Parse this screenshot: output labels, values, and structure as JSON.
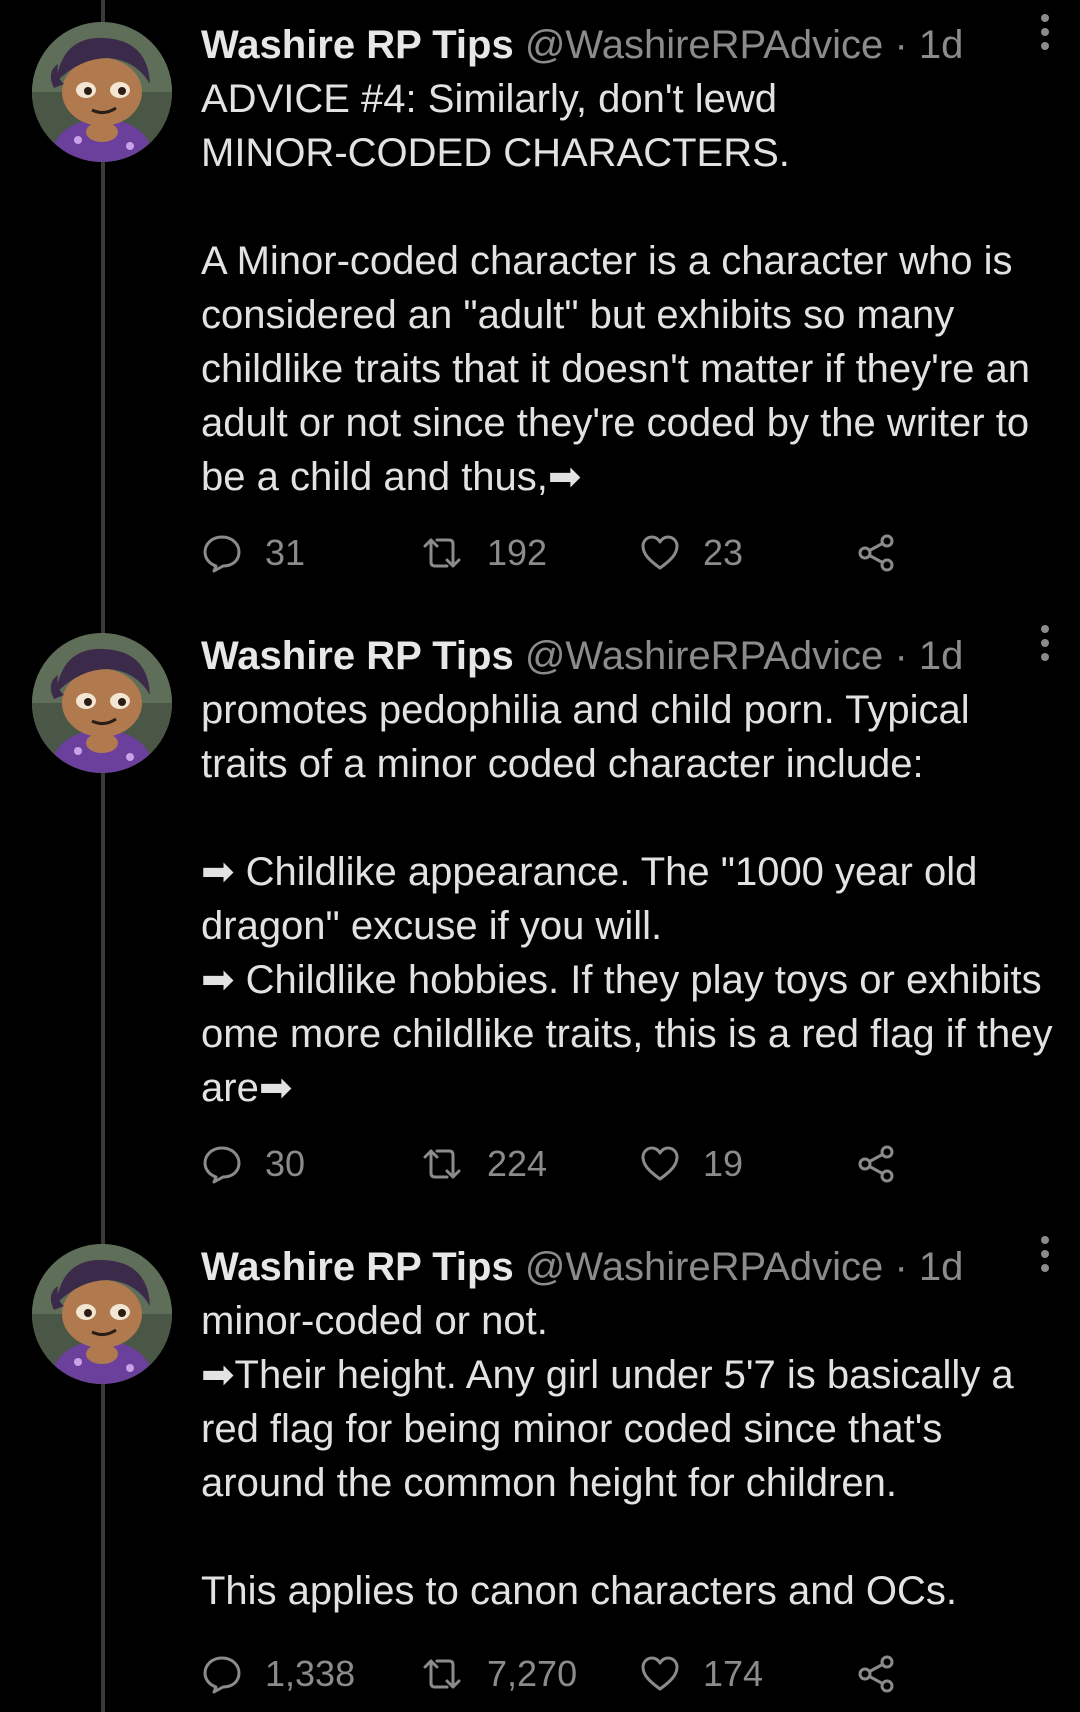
{
  "colors": {
    "background": "#000000",
    "text": "#e2e2e2",
    "secondary": "#8b8b8b",
    "thread_line": "#3a3a3a"
  },
  "tweets": [
    {
      "display_name": "Washire RP Tips",
      "handle": "@WashireRPAdvice",
      "separator": "·",
      "time": "1d",
      "text": "ADVICE #4: Similarly, don't lewd\nMINOR-CODED CHARACTERS.\n\nA Minor-coded character is a character who is considered an \"adult\" but exhibits so many childlike traits that it doesn't matter if they're an adult or not since they're coded by the writer to be a child and thus,➡",
      "replies": "31",
      "retweets": "192",
      "likes": "23",
      "icons": [
        "more-vertical-icon",
        "reply-icon",
        "retweet-icon",
        "heart-icon",
        "share-icon"
      ]
    },
    {
      "display_name": "Washire RP Tips",
      "handle": "@WashireRPAdvice",
      "separator": "·",
      "time": "1d",
      "text": "promotes pedophilia and child porn. Typical traits of a minor coded character include:\n\n➡ Childlike appearance. The \"1000 year old dragon\" excuse if you will.\n➡ Childlike hobbies. If they play toys or exhibits ome more childlike traits, this is a red flag if they are➡",
      "replies": "30",
      "retweets": "224",
      "likes": "19",
      "icons": [
        "more-vertical-icon",
        "reply-icon",
        "retweet-icon",
        "heart-icon",
        "share-icon"
      ]
    },
    {
      "display_name": "Washire RP Tips",
      "handle": "@WashireRPAdvice",
      "separator": "·",
      "time": "1d",
      "text": "minor-coded or not.\n➡Their height. Any girl under 5'7 is basically a red flag for being minor coded since that's around the common height for children.\n\nThis applies to canon characters and OCs.",
      "replies": "1,338",
      "retweets": "7,270",
      "likes": "174",
      "icons": [
        "more-vertical-icon",
        "reply-icon",
        "retweet-icon",
        "heart-icon",
        "share-icon"
      ]
    }
  ]
}
